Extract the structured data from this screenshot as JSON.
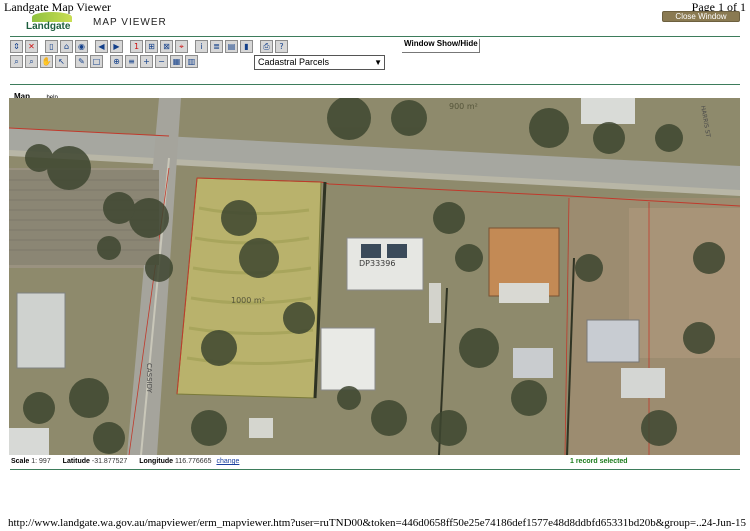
{
  "print_header": {
    "title": "Landgate Map Viewer",
    "page": "Page 1 of 1"
  },
  "header": {
    "logo_text": "Landgate",
    "app_title": "MAP VIEWER",
    "close_label": "Close Window"
  },
  "toolbar": {
    "row1_icons": [
      "refresh-icon",
      "clear-icon",
      "document-icon",
      "home-icon",
      "full-extent-icon",
      "previous-extent-icon",
      "next-extent-icon",
      "scale-icon",
      "zoom-extent-icon",
      "zoom-layer-icon",
      "zoom-selection-icon",
      "identify-icon",
      "select-list-icon",
      "report-icon",
      "layer-icon",
      "print-icon",
      "help-icon"
    ],
    "row2_icons": [
      "zoom-in-icon",
      "zoom-out-icon",
      "pan-icon",
      "select-arrow-icon",
      "pen-icon",
      "rectangle-icon",
      "add-layer-icon",
      "layer-stack-icon",
      "add-point-icon",
      "remove-point-icon",
      "grid-icon",
      "table-icon"
    ],
    "layer_selected": "Cadastral Parcels",
    "window_toggle_label": "Window Show/Hide"
  },
  "tabs": {
    "map": "Map",
    "help": "help"
  },
  "map": {
    "parcel_label": "1000 m²",
    "street_label_vertical": "CASSIDY",
    "lot_label": "DP33396",
    "corner_area_label": "900 m²",
    "corner_street_label": "HARRIS ST"
  },
  "status": {
    "scale_label": "Scale",
    "scale_value": "1: 997",
    "latitude_label": "Latitude",
    "latitude_value": "-31.877527",
    "longitude_label": "Longitude",
    "longitude_value": "116.776665",
    "change_label": "change",
    "records_text": "1 record selected"
  },
  "footer": {
    "url": "http://www.landgate.wa.gov.au/mapviewer/erm_mapviewer.htm?user=ruTND00&token=446d0658ff50e25e74186def1577e48d8ddbfd65331bd20b&group=...",
    "date": "24-Jun-15"
  },
  "colors": {
    "brand_green": "#3d7c5b",
    "link_blue": "#1a3f9e",
    "status_green": "#1a7a1a",
    "parcel_line": "#c0392b"
  }
}
